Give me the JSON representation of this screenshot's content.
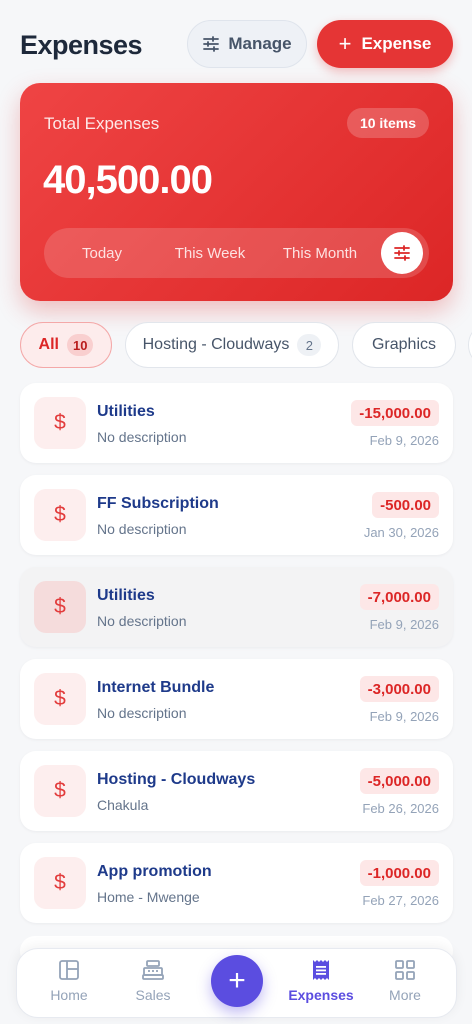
{
  "header": {
    "title": "Expenses",
    "manage_label": "Manage",
    "add_expense_label": "Expense"
  },
  "summary": {
    "label": "Total Expenses",
    "count_badge": "10 items",
    "amount": "40,500.00",
    "periods": [
      "Today",
      "This Week",
      "This Month"
    ]
  },
  "categories": [
    {
      "label": "All",
      "count": "10",
      "active": true
    },
    {
      "label": "Hosting - Cloudways",
      "count": "2",
      "active": false
    },
    {
      "label": "Graphics",
      "count": "",
      "active": false
    }
  ],
  "expenses": [
    {
      "icon": "$",
      "title": "Utilities",
      "description": "No description",
      "amount": "-15,000.00",
      "date": "Feb 9, 2026"
    },
    {
      "icon": "$",
      "title": "FF Subscription",
      "description": "No description",
      "amount": "-500.00",
      "date": "Jan 30, 2026"
    },
    {
      "icon": "$",
      "title": "Utilities",
      "description": "No description",
      "amount": "-7,000.00",
      "date": "Feb 9, 2026"
    },
    {
      "icon": "$",
      "title": "Internet Bundle",
      "description": "No description",
      "amount": "-3,000.00",
      "date": "Feb 9, 2026"
    },
    {
      "icon": "$",
      "title": "Hosting - Cloudways",
      "description": "Chakula",
      "amount": "-5,000.00",
      "date": "Feb 26, 2026"
    },
    {
      "icon": "$",
      "title": "App promotion",
      "description": "Home - Mwenge",
      "amount": "-1,000.00",
      "date": "Feb 27, 2026"
    }
  ],
  "nav": {
    "home": "Home",
    "sales": "Sales",
    "add": "+",
    "expenses": "Expenses",
    "more": "More"
  },
  "colors": {
    "accent_red": "#e53535",
    "nav_active": "#5b4de0",
    "title_blue": "#1e3a8a"
  }
}
